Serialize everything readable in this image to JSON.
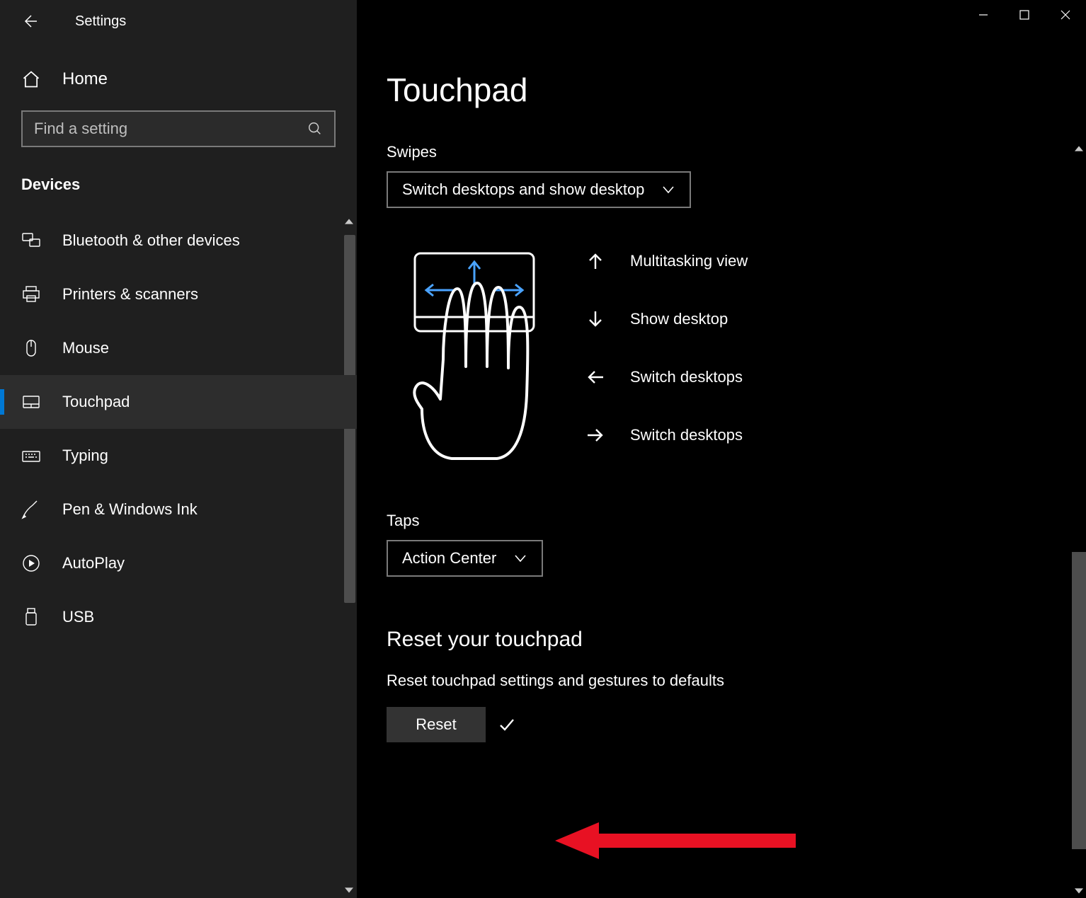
{
  "header": {
    "app_title": "Settings"
  },
  "sidebar": {
    "home_label": "Home",
    "search_placeholder": "Find a setting",
    "section_heading": "Devices",
    "items": [
      {
        "label": "Bluetooth & other devices",
        "icon": "devices-icon",
        "active": false
      },
      {
        "label": "Printers & scanners",
        "icon": "printer-icon",
        "active": false
      },
      {
        "label": "Mouse",
        "icon": "mouse-icon",
        "active": false
      },
      {
        "label": "Touchpad",
        "icon": "touchpad-icon",
        "active": true
      },
      {
        "label": "Typing",
        "icon": "keyboard-icon",
        "active": false
      },
      {
        "label": "Pen & Windows Ink",
        "icon": "pen-icon",
        "active": false
      },
      {
        "label": "AutoPlay",
        "icon": "autoplay-icon",
        "active": false
      },
      {
        "label": "USB",
        "icon": "usb-icon",
        "active": false
      }
    ]
  },
  "main": {
    "page_title": "Touchpad",
    "swipes": {
      "label": "Swipes",
      "selected": "Switch desktops and show desktop"
    },
    "gesture_legend": [
      {
        "dir": "up",
        "label": "Multitasking view"
      },
      {
        "dir": "down",
        "label": "Show desktop"
      },
      {
        "dir": "left",
        "label": "Switch desktops"
      },
      {
        "dir": "right",
        "label": "Switch desktops"
      }
    ],
    "taps": {
      "label": "Taps",
      "selected": "Action Center"
    },
    "reset": {
      "heading": "Reset your touchpad",
      "description": "Reset touchpad settings and gestures to defaults",
      "button": "Reset"
    }
  }
}
